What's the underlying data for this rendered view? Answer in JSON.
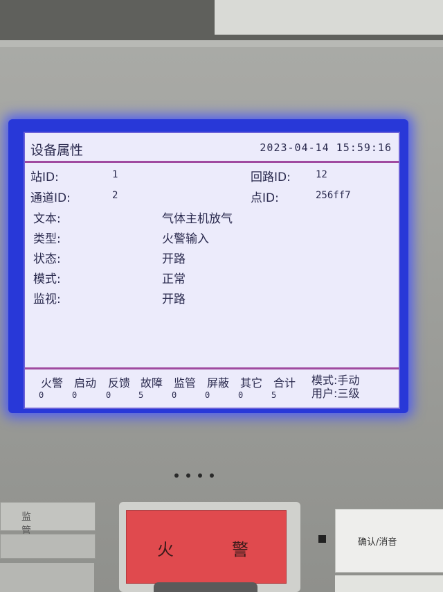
{
  "screen": {
    "title": "设备属性",
    "datetime": "2023-04-14 15:59:16"
  },
  "fields": {
    "station_label": "站ID:",
    "station_value": "1",
    "loop_label": "回路ID:",
    "loop_value": "12",
    "channel_label": "通道ID:",
    "channel_value": "2",
    "point_label": "点ID:",
    "point_value": "256ff7",
    "text_label": "文本:",
    "text_value": "气体主机放气",
    "type_label": "类型:",
    "type_value": "火警输入",
    "state_label": "状态:",
    "state_value": "开路",
    "mode_label": "模式:",
    "mode_value": "正常",
    "monitor_label": "监视:",
    "monitor_value": "开路"
  },
  "status_bar": {
    "items": [
      {
        "label": "火警",
        "count": "0"
      },
      {
        "label": "启动",
        "count": "0"
      },
      {
        "label": "反馈",
        "count": "0"
      },
      {
        "label": "故障",
        "count": "5"
      },
      {
        "label": "监管",
        "count": "0"
      },
      {
        "label": "屏蔽",
        "count": "0"
      },
      {
        "label": "其它",
        "count": "0"
      },
      {
        "label": "合计",
        "count": "5"
      }
    ],
    "mode_text": "模式:手动",
    "user_text": "用户:三级"
  },
  "panel_buttons": {
    "left_button": "监 管",
    "fire_button_left": "火",
    "fire_button_right": "警",
    "ack_button": "确认/消音"
  },
  "colors": {
    "bezel": "#2838d8",
    "lcd_background": "#ecebfb",
    "separator": "#a04aa0",
    "lcd_text": "#2a2a4e",
    "fire_button": "#e04a4e"
  }
}
